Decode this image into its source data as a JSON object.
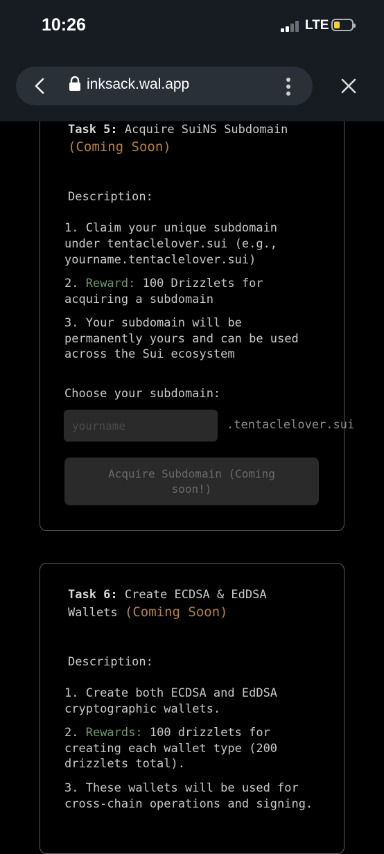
{
  "status_bar": {
    "time": "10:26",
    "network": "LTE"
  },
  "browser": {
    "url": "inksack.wal.app"
  },
  "task5": {
    "label": "Task 5:",
    "title": "Acquire SuiNS Subdomain",
    "status": "(Coming Soon)",
    "description_label": "Description:",
    "item1_l1": "1. Claim your unique subdomain",
    "item1_l2": "under tentaclelover.sui (e.g.,",
    "item1_l3": "yourname.tentaclelover.sui)",
    "item2_prefix": "2. ",
    "item2_highlight": "Reward:",
    "item2_l1_rest": " 100 Drizzlets for",
    "item2_l2": "acquiring a subdomain",
    "item3_l1": "3. Your subdomain will be",
    "item3_l2": "permanently yours and can be used",
    "item3_l3": "across the Sui ecosystem",
    "choose_label": "Choose your subdomain:",
    "input_placeholder": "yourname",
    "suffix": ".tentaclelover.sui",
    "button_label": "Acquire Subdomain (Coming soon!)"
  },
  "task6": {
    "label": "Task 6:",
    "title_l1": "Create ECDSA & EdDSA",
    "title_l2": "Wallets",
    "status": "(Coming Soon)",
    "description_label": "Description:",
    "item1_l1": "1. Create both ECDSA and EdDSA",
    "item1_l2": "cryptographic wallets.",
    "item2_prefix": "2. ",
    "item2_highlight": "Rewards:",
    "item2_l1_rest": " 100 drizzlets for",
    "item2_l2": "creating each wallet type (200",
    "item2_l3": "drizzlets total).",
    "item3_l1": "3. These wallets will be used for",
    "item3_l2": "cross-chain operations and signing."
  }
}
